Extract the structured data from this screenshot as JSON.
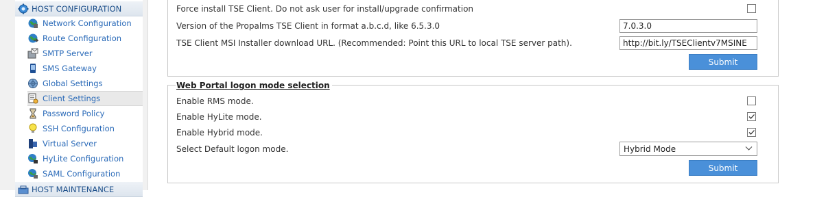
{
  "sidebar": {
    "host_configuration": {
      "label": "HOST CONFIGURATION",
      "icon": "gear-icon"
    },
    "items": [
      {
        "label": "Network Configuration",
        "icon": "globe-network-icon"
      },
      {
        "label": "Route Configuration",
        "icon": "globe-route-icon"
      },
      {
        "label": "SMTP Server",
        "icon": "mail-server-icon"
      },
      {
        "label": "SMS Gateway",
        "icon": "phone-icon"
      },
      {
        "label": "Global Settings",
        "icon": "globe-settings-icon"
      },
      {
        "label": "Client Settings",
        "icon": "document-settings-icon"
      },
      {
        "label": "Password Policy",
        "icon": "hourglass-icon"
      },
      {
        "label": "SSH Configuration",
        "icon": "lightbulb-icon"
      },
      {
        "label": "Virtual Server",
        "icon": "server-icon"
      },
      {
        "label": "HyLite Configuration",
        "icon": "globe-key-icon"
      },
      {
        "label": "SAML Configuration",
        "icon": "globe-lock-icon"
      }
    ],
    "active_item": "Client Settings",
    "host_maintenance": {
      "label": "HOST MAINTENANCE",
      "icon": "tools-icon"
    }
  },
  "tse_client": {
    "force_install_label": "Force install TSE Client. Do not ask user for install/upgrade confirmation",
    "force_install_checked": false,
    "version_label": "Version of the Propalms TSE Client in format a.b.c.d, like 6.5.3.0",
    "version_value": "7.0.3.0",
    "msi_url_label": "TSE Client MSI Installer download URL. (Recommended: Point this URL to local TSE server path).",
    "msi_url_value": "http://bit.ly/TSEClientv7MSINE",
    "submit_label": "Submit"
  },
  "web_portal": {
    "legend": "Web Portal logon mode selection",
    "rms_label": "Enable RMS mode.",
    "rms_checked": false,
    "hylite_label": "Enable HyLite mode.",
    "hylite_checked": true,
    "hybrid_label": "Enable Hybrid mode.",
    "hybrid_checked": true,
    "default_mode_label": "Select Default logon mode.",
    "default_mode_value": "Hybrid Mode",
    "submit_label": "Submit"
  },
  "colors": {
    "accent_button": "#4a90d9",
    "nav_link": "#2a6ab8",
    "section_header": "#1d4f8a"
  }
}
